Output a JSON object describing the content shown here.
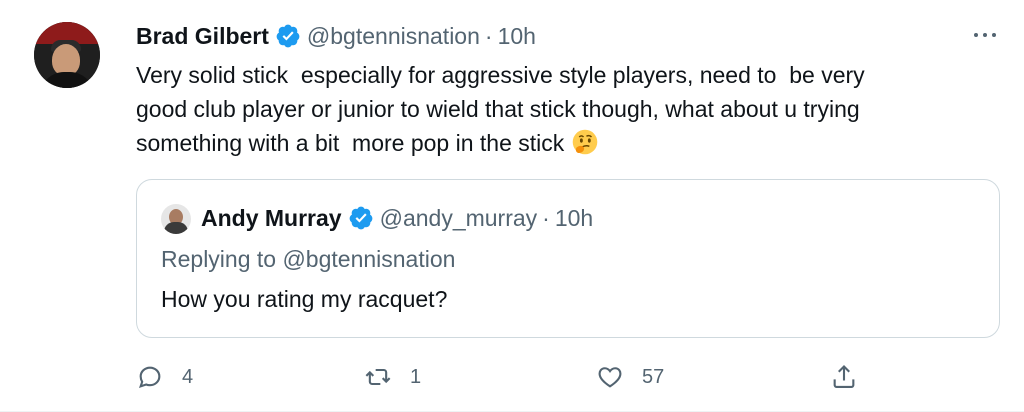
{
  "tweet": {
    "author": {
      "name": "Brad Gilbert",
      "handle": "@bgtennisnation",
      "separator": "·",
      "time": "10h",
      "verified_color": "#1d9bf0"
    },
    "text_lines": [
      "Very solid stick  especially for aggressive style players, need to  be very",
      "good club player or junior to wield that stick though, what about u trying",
      "something with a bit  more pop in the stick"
    ],
    "emoji": "thinking-face",
    "more_icon": "more-horizontal-icon",
    "quote": {
      "name": "Andy Murray",
      "handle": "@andy_murray",
      "separator": "·",
      "time": "10h",
      "replying_to": "Replying to @bgtennisnation",
      "text": "How you rating my racquet?"
    },
    "actions": {
      "reply_count": "4",
      "retweet_count": "1",
      "like_count": "57",
      "reply_icon": "reply-icon",
      "retweet_icon": "retweet-icon",
      "like_icon": "heart-icon",
      "share_icon": "share-icon"
    }
  }
}
